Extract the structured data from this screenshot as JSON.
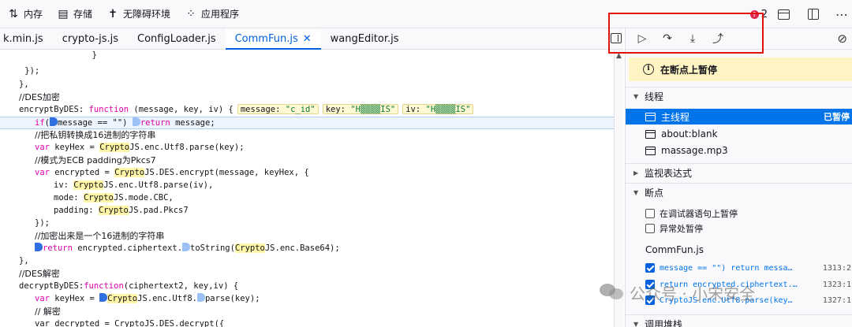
{
  "toolbar": {
    "items": [
      {
        "icon": "memory-icon",
        "glyph": "⇅",
        "label": "内存"
      },
      {
        "icon": "storage-icon",
        "glyph": "▤",
        "label": "存储"
      },
      {
        "icon": "accessibility-icon",
        "glyph": "✝",
        "label": "无障碍环境"
      },
      {
        "icon": "app-grid-icon",
        "glyph": "⁘",
        "label": "应用程序"
      }
    ],
    "error_badge": "!",
    "error_count": "2"
  },
  "tabs": [
    {
      "label": "k.min.js"
    },
    {
      "label": "crypto-js.js"
    },
    {
      "label": "ConfigLoader.js"
    },
    {
      "label": "CommFun.js",
      "active": true,
      "close": "✕"
    },
    {
      "label": "wangEditor.js"
    }
  ],
  "code": {
    "l1": "        }",
    "l2": "    });",
    "l3": "},",
    "l4": "//DES加密",
    "l5_a": "encryptByDES: ",
    "l5_kw": "function",
    "l5_b": " (message, key, iv) {",
    "l5_p1k": "message: ",
    "l5_p1v": "\"c_id\"",
    "l5_p2k": "key: ",
    "l5_p2v": "\"H▒▒▒▒IS\"",
    "l5_p3k": "iv: ",
    "l5_p3v": "\"H▒▒▒▒IS\"",
    "l6_kw": "if",
    "l6_a": "(",
    "l6_b": "message == \"\") ",
    "l6_kw2": "return",
    "l6_c": " message;",
    "l7": "//把私钥转换成16进制的字符串",
    "l8_kw": "var",
    "l8_a": " keyHex = ",
    "l8_h": "Crypto",
    "l8_b": "JS.enc.Utf8.parse(key);",
    "l9": "//模式为ECB padding为Pkcs7",
    "l10_kw": "var",
    "l10_a": " encrypted = ",
    "l10_h": "Crypto",
    "l10_b": "JS.DES.encrypt(message, keyHex, {",
    "l11_a": "iv: ",
    "l11_h": "Crypto",
    "l11_b": "JS.enc.Utf8.parse(iv),",
    "l12_a": "mode: ",
    "l12_h": "Crypto",
    "l12_b": "JS.mode.CBC,",
    "l13_a": "padding: ",
    "l13_h": "Crypto",
    "l13_b": "JS.pad.Pkcs7",
    "l14": "});",
    "l15": "//加密出来是一个16进制的字符串",
    "l16_kw": "return",
    "l16_a": " encrypted.ciphertext.",
    "l16_b": "toString(",
    "l16_h": "Crypto",
    "l16_c": "JS.enc.Base64);",
    "l17": "},",
    "l18": "//DES解密",
    "l19_a": "decryptByDES:",
    "l19_kw": "function",
    "l19_b": "(ciphertext2, key,iv) {",
    "l20_kw": "var",
    "l20_a": " keyHex = ",
    "l20_h": "Crypto",
    "l20_b": "JS.enc.Utf8.",
    "l20_c": "parse(key);",
    "l21": "// 解密",
    "l22": "var decrypted = CryptoJS.DES.decrypt({"
  },
  "debugger": {
    "resume_glyph": "▷",
    "step_over_glyph": "↷",
    "step_in_glyph": "⤓",
    "step_out_glyph": "⤴",
    "deactivate_glyph": "⊘",
    "paused_label": "在断点上暂停",
    "info_glyph": "i",
    "threads_label": "线程",
    "threads": [
      {
        "label": "主线程",
        "tag": "已暂停"
      },
      {
        "label": "about:blank"
      },
      {
        "label": "massage.mp3"
      }
    ],
    "watch_label": "监视表达式",
    "breakpoints_label": "断点",
    "pause_on_debugger": "在调试器语句上暂停",
    "pause_on_exceptions": "异常处暂停",
    "bp_file": "CommFun.js",
    "breakpoints": [
      {
        "text": "message == \"\") return messa…",
        "loc": "1313:2"
      },
      {
        "text": "return encrypted.ciphertext.…",
        "loc": "1323:1"
      },
      {
        "text": "CryptoJS.enc.Utf8.parse(key…",
        "loc": "1327:1"
      }
    ],
    "callstack_label": "调用堆栈"
  },
  "watermark": "公众号 · 小宋安全"
}
